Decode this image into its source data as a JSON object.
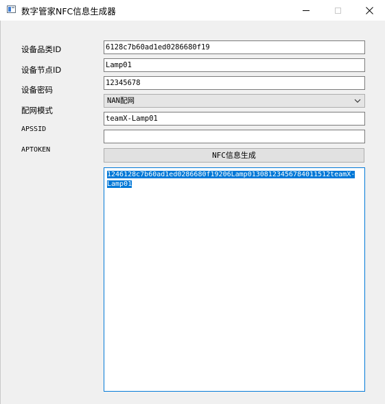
{
  "window": {
    "title": "数字管家NFC信息生成器",
    "accent": "#0078d7"
  },
  "form": {
    "category_label": "设备品类ID",
    "category_value": "6128c7b60ad1ed0286680f19",
    "node_label": "设备节点ID",
    "node_value": "Lamp01",
    "password_label": "设备密码",
    "password_value": "12345678",
    "mode_label": "配网模式",
    "mode_value": "NAN配网",
    "mode_extra_value": "teamX-Lamp01",
    "apssid_label": "APSSID",
    "apssid_value": "",
    "aptoken_label": "APTOKEN"
  },
  "generate_button": "NFC信息生成",
  "output": {
    "line1": "1246128c7b60ad1ed0286680f19206Lamp01308123456784011512teamX-",
    "line2": "Lamp01"
  },
  "icons": {
    "app": "app-window-icon",
    "minimize": "minimize-icon",
    "maximize": "maximize-icon",
    "close": "close-icon",
    "dropdown": "chevron-down-icon"
  }
}
